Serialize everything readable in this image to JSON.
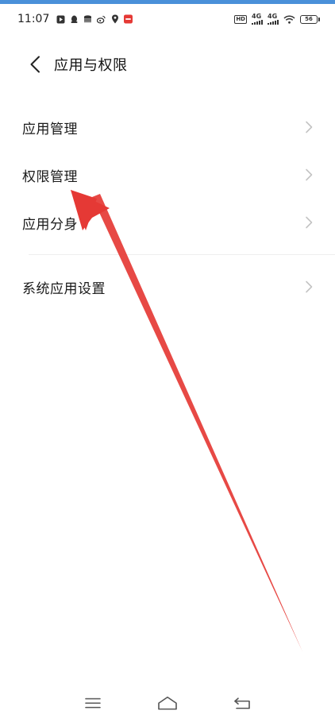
{
  "status_bar": {
    "time": "11:07",
    "left_icons": [
      "video-app-icon",
      "qq-icon",
      "database-icon",
      "weibo-icon",
      "location-icon",
      "red-app-icon"
    ],
    "hd_label": "HD",
    "sim1_label": "4G",
    "sim2_label": "4G",
    "battery_level": "56"
  },
  "header": {
    "back_icon": "chevron-left-icon",
    "title": "应用与权限"
  },
  "menu": {
    "items": [
      {
        "label": "应用管理"
      },
      {
        "label": "权限管理"
      },
      {
        "label": "应用分身"
      },
      {
        "label": "系统应用设置"
      }
    ]
  },
  "annotation": {
    "type": "red-arrow",
    "color": "#e53935",
    "points_to": "权限管理"
  },
  "nav_bar": {
    "icons": [
      "menu-icon",
      "home-icon",
      "back-icon"
    ]
  },
  "colors": {
    "accent": "#4a90d9",
    "text": "#1a1a1a",
    "chevron": "#c4c4c4",
    "arrow": "#e53935"
  }
}
